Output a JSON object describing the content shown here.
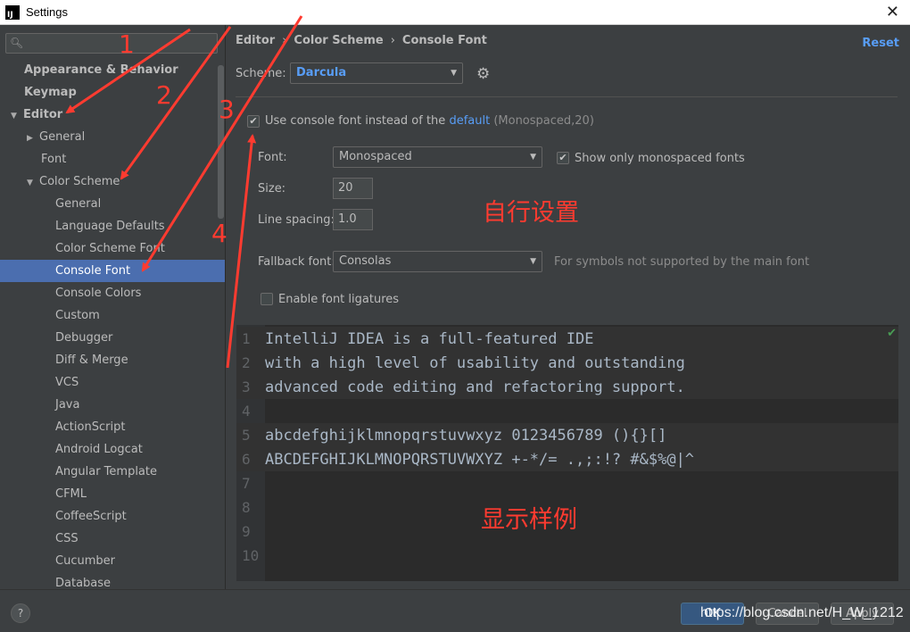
{
  "window": {
    "title": "Settings",
    "logo": "IJ"
  },
  "sidebar": {
    "search_placeholder": "",
    "items": [
      {
        "label": "Appearance & Behavior",
        "level": 0,
        "bold": true
      },
      {
        "label": "Keymap",
        "level": 0,
        "bold": true
      },
      {
        "label": "Editor",
        "level": 0,
        "bold": true,
        "expanded": true
      },
      {
        "label": "General",
        "level": 1,
        "collapsed": true
      },
      {
        "label": "Font",
        "level": 1
      },
      {
        "label": "Color Scheme",
        "level": 1,
        "expanded": true
      },
      {
        "label": "General",
        "level": 2
      },
      {
        "label": "Language Defaults",
        "level": 2
      },
      {
        "label": "Color Scheme Font",
        "level": 2
      },
      {
        "label": "Console Font",
        "level": 2,
        "selected": true
      },
      {
        "label": "Console Colors",
        "level": 2
      },
      {
        "label": "Custom",
        "level": 2
      },
      {
        "label": "Debugger",
        "level": 2
      },
      {
        "label": "Diff & Merge",
        "level": 2
      },
      {
        "label": "VCS",
        "level": 2
      },
      {
        "label": "Java",
        "level": 2
      },
      {
        "label": "ActionScript",
        "level": 2
      },
      {
        "label": "Android Logcat",
        "level": 2
      },
      {
        "label": "Angular Template",
        "level": 2
      },
      {
        "label": "CFML",
        "level": 2
      },
      {
        "label": "CoffeeScript",
        "level": 2
      },
      {
        "label": "CSS",
        "level": 2
      },
      {
        "label": "Cucumber",
        "level": 2
      },
      {
        "label": "Database",
        "level": 2
      }
    ]
  },
  "breadcrumb": [
    "Editor",
    "Color Scheme",
    "Console Font"
  ],
  "reset_label": "Reset",
  "scheme": {
    "label": "Scheme:",
    "value": "Darcula"
  },
  "use_console_font": {
    "checked": true,
    "text_before": "Use console font instead of the",
    "link": "default",
    "hint": "(Monospaced,20)"
  },
  "font": {
    "label": "Font:",
    "value": "Monospaced",
    "show_only_mono_label": "Show only monospaced fonts",
    "show_only_mono_checked": true
  },
  "size": {
    "label": "Size:",
    "value": "20"
  },
  "line_spacing": {
    "label": "Line spacing:",
    "value": "1.0"
  },
  "fallback": {
    "label": "Fallback font:",
    "value": "Consolas",
    "hint": "For symbols not supported by the main font"
  },
  "ligatures": {
    "label": "Enable font ligatures",
    "checked": false
  },
  "preview_lines": [
    {
      "n": "1",
      "text": "IntelliJ IDEA is a full-featured IDE"
    },
    {
      "n": "2",
      "text": "with a high level of usability and outstanding"
    },
    {
      "n": "3",
      "text": "advanced code editing and refactoring support."
    },
    {
      "n": "4",
      "text": ""
    },
    {
      "n": "5",
      "text": "abcdefghijklmnopqrstuvwxyz 0123456789 (){}[]"
    },
    {
      "n": "6",
      "text": "ABCDEFGHIJKLMNOPQRSTUVWXYZ +-*/= .,;:!? #&$%@|^"
    },
    {
      "n": "7",
      "text": ""
    },
    {
      "n": "8",
      "text": ""
    },
    {
      "n": "9",
      "text": ""
    },
    {
      "n": "10",
      "text": ""
    }
  ],
  "annotations": {
    "numbers": [
      "1",
      "2",
      "3",
      "4"
    ],
    "custom_setting": "自行设置",
    "sample_display": "显示样例",
    "color": "#ff3b30"
  },
  "buttons": {
    "ok": "OK",
    "cancel": "Cancel",
    "apply": "Apply",
    "help": "?"
  },
  "watermark": "https://blog.csdn.net/H_W_1212"
}
